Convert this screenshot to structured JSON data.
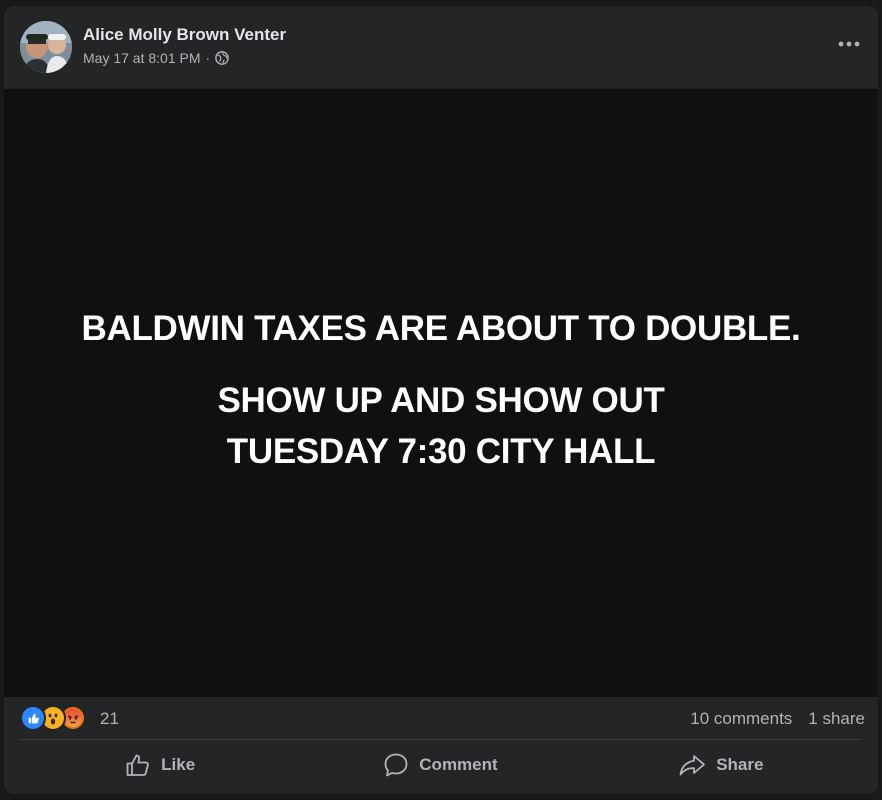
{
  "post": {
    "author": "Alice Molly Brown Venter",
    "timestamp": "May 17 at 8:01 PM",
    "separator": "·",
    "privacy_icon": "globe-icon",
    "more_icon": "more-horizontal-icon"
  },
  "image": {
    "headline": "BALDWIN TAXES ARE ABOUT TO DOUBLE.",
    "line2": "SHOW UP AND SHOW OUT",
    "line3": "TUESDAY 7:30 CITY HALL"
  },
  "stats": {
    "reactions": [
      "like",
      "wow",
      "angry"
    ],
    "reaction_count": "21",
    "comments": "10 comments",
    "shares": "1 share"
  },
  "actions": {
    "like": "Like",
    "comment": "Comment",
    "share": "Share"
  },
  "colors": {
    "card_bg": "#242526",
    "image_bg": "#101011",
    "primary_text": "#e4e6eb",
    "secondary_text": "#b0b3b8",
    "like_blue": "#2d88ff",
    "wow_yellow": "#f7b125",
    "angry_red": "#e9710f"
  }
}
